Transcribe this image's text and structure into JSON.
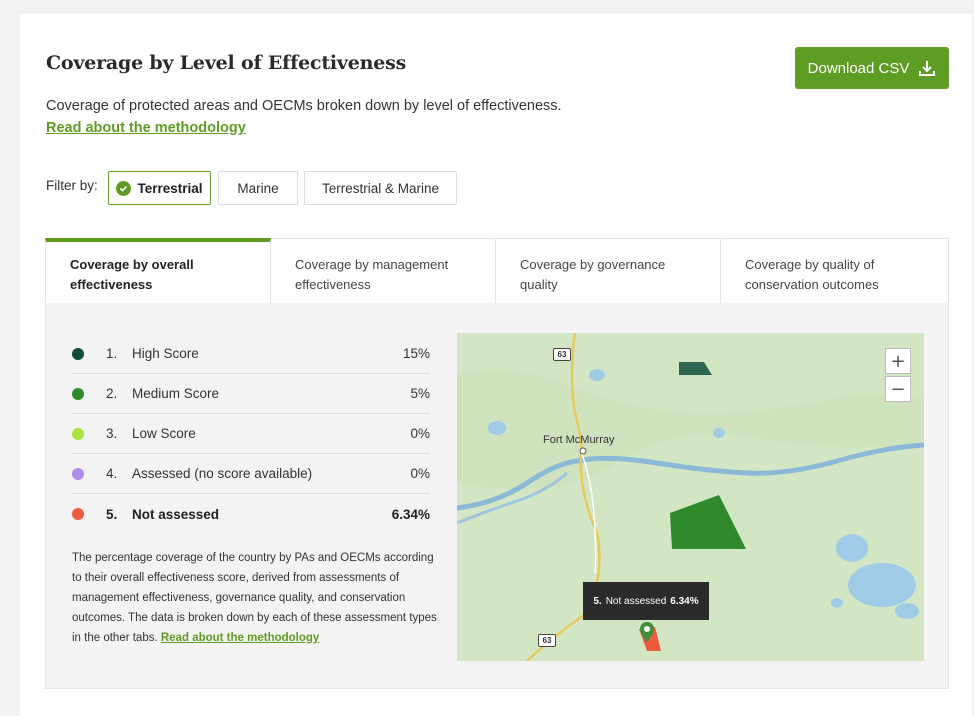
{
  "header": {
    "title": "Coverage by Level of Effectiveness",
    "download_label": "Download CSV",
    "description": "Coverage of protected areas and OECMs broken down by level of effectiveness.",
    "methodology_link": "Read about the methodology"
  },
  "filter": {
    "label": "Filter by:",
    "options": [
      "Terrestrial",
      "Marine",
      "Terrestrial & Marine"
    ],
    "selected": "Terrestrial"
  },
  "tabs": [
    {
      "label": "Coverage by overall effectiveness",
      "active": true
    },
    {
      "label": "Coverage by management effectiveness",
      "active": false
    },
    {
      "label": "Coverage by governance quality",
      "active": false
    },
    {
      "label": "Coverage by quality of conservation outcomes",
      "active": false
    }
  ],
  "legend": [
    {
      "num": "1.",
      "label": "High Score",
      "value": "15%",
      "color": "#0f4d3a"
    },
    {
      "num": "2.",
      "label": "Medium Score",
      "value": "5%",
      "color": "#2f8a2c"
    },
    {
      "num": "3.",
      "label": "Low Score",
      "value": "0%",
      "color": "#a6e63c"
    },
    {
      "num": "4.",
      "label": "Assessed (no score available)",
      "value": "0%",
      "color": "#b08ae8"
    },
    {
      "num": "5.",
      "label": "Not assessed",
      "value": "6.34%",
      "color": "#ee5a3f"
    }
  ],
  "note": {
    "text": "The percentage coverage of the country by PAs and OECMs according to their overall effectiveness score, derived from assessments of management effectiveness, governance quality, and conservation outcomes. The data is broken down by each of these assessment types in the other tabs.",
    "link": "Read about the methodology"
  },
  "map": {
    "city_label": "Fort McMurray",
    "highway_top": "63",
    "highway_bottom": "63",
    "zoom_in": "+",
    "zoom_out": "−",
    "tooltip_num": "5.",
    "tooltip_label": "Not assessed",
    "tooltip_value": "6.34%"
  }
}
